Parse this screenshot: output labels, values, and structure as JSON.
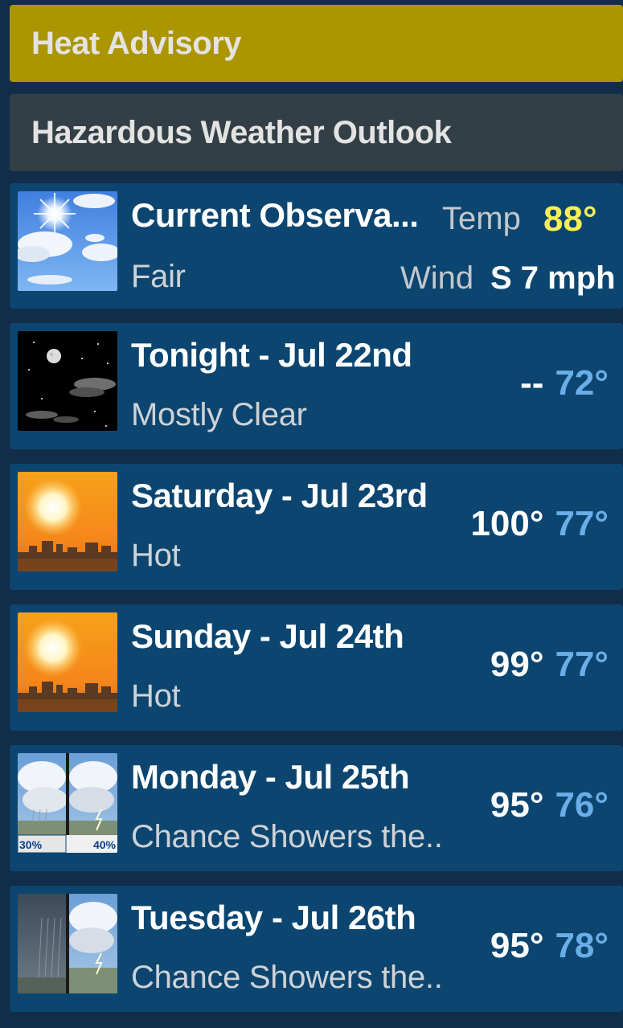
{
  "alerts": [
    {
      "label": "Heat Advisory"
    },
    {
      "label": "Hazardous Weather Outlook"
    }
  ],
  "current": {
    "title": "Current Observa...",
    "condition": "Fair",
    "temp_label": "Temp",
    "temp_value": "88°",
    "wind_label": "Wind",
    "wind_value": "S 7 mph",
    "icon": "sunny-clouds-icon",
    "temp_color": "#f6ef5a"
  },
  "forecast": [
    {
      "title": "Tonight - Jul 22nd",
      "condition": "Mostly Clear",
      "high": "--",
      "low": "72°",
      "icon": "night-clear-icon"
    },
    {
      "title": "Saturday - Jul 23rd",
      "condition": "Hot",
      "high": "100°",
      "low": "77°",
      "icon": "hot-sun-icon"
    },
    {
      "title": "Sunday - Jul 24th",
      "condition": "Hot",
      "high": "99°",
      "low": "77°",
      "icon": "hot-sun-icon"
    },
    {
      "title": "Monday - Jul 25th",
      "condition": "Chance Showers the..",
      "high": "95°",
      "low": "76°",
      "icon": "showers-storm-icon",
      "icon_left_pct": "30%",
      "icon_right_pct": "40%"
    },
    {
      "title": "Tuesday - Jul 26th",
      "condition": "Chance Showers the..",
      "high": "95°",
      "low": "78°",
      "icon": "showers-storm-icon"
    }
  ],
  "colors": {
    "background": "#112d4a",
    "row": "#0c4670",
    "heat_advisory": "#ab9600",
    "outlook": "#333f46",
    "low_temp": "#6aaee8"
  }
}
